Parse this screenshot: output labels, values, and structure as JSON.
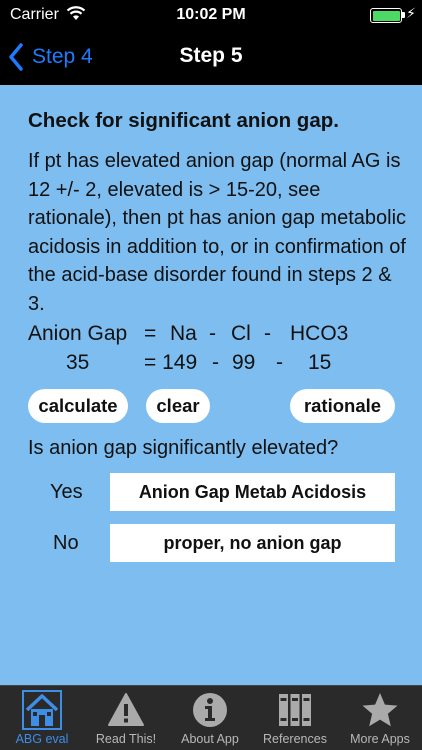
{
  "status_bar": {
    "carrier": "Carrier",
    "time": "10:02 PM"
  },
  "nav": {
    "back_label": "Step 4",
    "title": "Step 5"
  },
  "content": {
    "heading": "Check for significant anion gap.",
    "paragraph": "If pt has elevated anion gap (normal AG is 12 +/- 2, elevated is > 15-20, see rationale), then pt has anion gap metabolic acidosis in addition to, or in confirmation of the acid-base disorder found in steps 2 & 3.",
    "formula": {
      "label": "Anion Gap",
      "eq": "=",
      "na_label": "Na",
      "minus": "-",
      "cl_label": "Cl",
      "hco3_label": "HCO3",
      "result": "35",
      "eq_value": "= 149",
      "cl_value": "99",
      "hco3_value": "15"
    },
    "buttons": {
      "calculate": "calculate",
      "clear": "clear",
      "rationale": "rationale"
    },
    "question": "Is anion gap significantly elevated?",
    "options": [
      {
        "label": "Yes",
        "value": "Anion Gap Metab Acidosis"
      },
      {
        "label": "No",
        "value": "proper, no anion gap"
      }
    ]
  },
  "tabs": [
    {
      "label": "ABG eval",
      "icon": "house-icon"
    },
    {
      "label": "Read This!",
      "icon": "warning-icon"
    },
    {
      "label": "About App",
      "icon": "info-icon"
    },
    {
      "label": "References",
      "icon": "books-icon"
    },
    {
      "label": "More Apps",
      "icon": "star-icon"
    }
  ]
}
